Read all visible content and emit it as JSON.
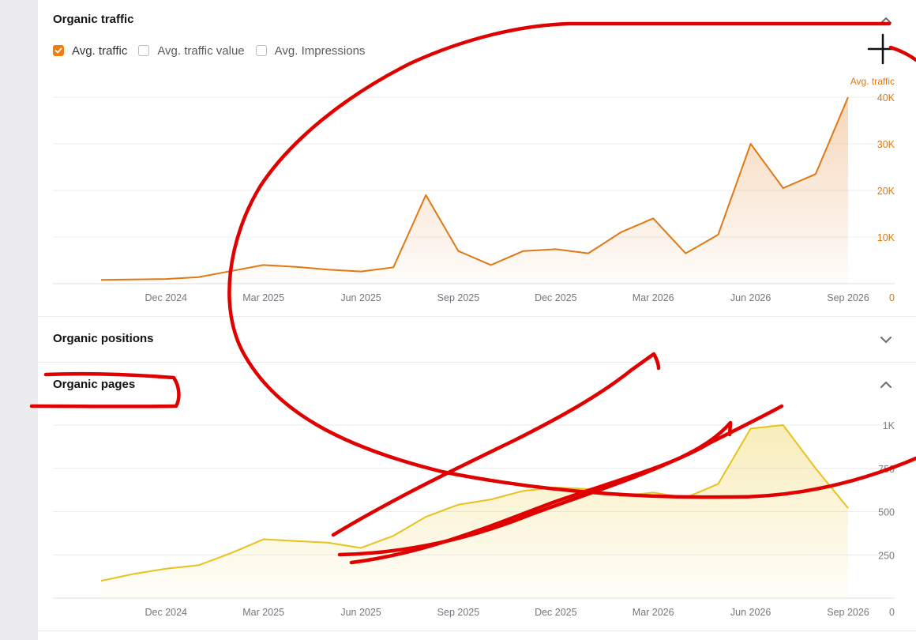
{
  "sections": {
    "organic_traffic": {
      "title": "Organic traffic"
    },
    "organic_positions": {
      "title": "Organic positions"
    },
    "organic_pages": {
      "title": "Organic pages"
    }
  },
  "legend": {
    "avg_traffic": {
      "label": "Avg. traffic",
      "checked": true
    },
    "avg_traffic_value": {
      "label": "Avg. traffic value",
      "checked": false
    },
    "avg_impressions": {
      "label": "Avg. Impressions",
      "checked": false
    }
  },
  "colors": {
    "traffic": "#e07815",
    "pages": "#e8c21a",
    "annotation": "#e00000"
  },
  "chart_data": [
    {
      "type": "area",
      "axis_label": "Avg. traffic",
      "x_ticks": [
        "Dec 2024",
        "Mar 2025",
        "Jun 2025",
        "Sep 2025",
        "Dec 2025",
        "Mar 2026",
        "Jun 2026",
        "Sep 2026"
      ],
      "y_ticks": [
        "0",
        "10K",
        "20K",
        "30K",
        "40K"
      ],
      "ylim": [
        0,
        40000
      ],
      "series": [
        {
          "values": [
            [
              "2024-10-01",
              800
            ],
            [
              "2024-12-01",
              1000
            ],
            [
              "2025-01-01",
              1400
            ],
            [
              "2025-02-01",
              2700
            ],
            [
              "2025-03-01",
              4000
            ],
            [
              "2025-04-01",
              3600
            ],
            [
              "2025-05-01",
              3000
            ],
            [
              "2025-06-01",
              2600
            ],
            [
              "2025-07-01",
              3500
            ],
            [
              "2025-08-01",
              19000
            ],
            [
              "2025-09-01",
              7000
            ],
            [
              "2025-10-01",
              4000
            ],
            [
              "2025-11-01",
              7000
            ],
            [
              "2025-12-01",
              7400
            ],
            [
              "2026-01-01",
              6500
            ],
            [
              "2026-02-01",
              11000
            ],
            [
              "2026-03-01",
              14000
            ],
            [
              "2026-04-01",
              6500
            ],
            [
              "2026-05-01",
              10500
            ],
            [
              "2026-06-01",
              30000
            ],
            [
              "2026-07-01",
              20500
            ],
            [
              "2026-08-01",
              23500
            ],
            [
              "2026-09-01",
              40000
            ]
          ]
        }
      ]
    },
    {
      "type": "area",
      "x_ticks": [
        "Dec 2024",
        "Mar 2025",
        "Jun 2025",
        "Sep 2025",
        "Dec 2025",
        "Mar 2026",
        "Jun 2026",
        "Sep 2026"
      ],
      "y_ticks": [
        "0",
        "250",
        "500",
        "750",
        "1K"
      ],
      "ylim": [
        0,
        1000
      ],
      "series": [
        {
          "values": [
            [
              "2024-10-01",
              100
            ],
            [
              "2024-11-01",
              140
            ],
            [
              "2024-12-01",
              170
            ],
            [
              "2025-01-01",
              190
            ],
            [
              "2025-02-01",
              260
            ],
            [
              "2025-03-01",
              340
            ],
            [
              "2025-04-01",
              330
            ],
            [
              "2025-05-01",
              320
            ],
            [
              "2025-06-01",
              290
            ],
            [
              "2025-07-01",
              360
            ],
            [
              "2025-08-01",
              470
            ],
            [
              "2025-09-01",
              540
            ],
            [
              "2025-10-01",
              570
            ],
            [
              "2025-11-01",
              620
            ],
            [
              "2025-12-01",
              640
            ],
            [
              "2026-01-01",
              630
            ],
            [
              "2026-02-01",
              590
            ],
            [
              "2026-03-01",
              610
            ],
            [
              "2026-04-01",
              580
            ],
            [
              "2026-05-01",
              660
            ],
            [
              "2026-06-01",
              980
            ],
            [
              "2026-07-01",
              1000
            ],
            [
              "2026-08-01",
              750
            ],
            [
              "2026-09-01",
              520
            ]
          ]
        }
      ]
    }
  ]
}
